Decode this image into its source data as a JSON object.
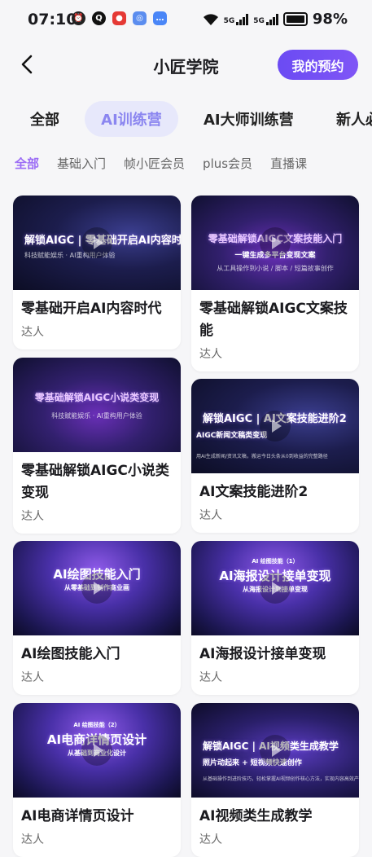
{
  "status": {
    "time": "07:10",
    "net1": "5G",
    "net2": "5G",
    "battery": "98%"
  },
  "header": {
    "title": "小匠学院",
    "booking_label": "我的预约"
  },
  "tabs": [
    "全部",
    "AI训练营",
    "AI大师训练营",
    "新人必"
  ],
  "subtabs": [
    "全部",
    "基础入门",
    "帧小匠会员",
    "plus会员",
    "直播课"
  ],
  "cards": [
    {
      "title": "零基础开启AI内容时代",
      "author": "达人",
      "thumb_main": "解锁AIGC | 零基础开启AI内容时代",
      "thumb_sub": "科技赋能娱乐 · AI重构用户体验"
    },
    {
      "title": "零基础解锁AIGC文案技能",
      "author": "达人",
      "thumb_main": "零基础解锁AIGC文案技能入门",
      "thumb_line2": "一键生成多平台变现文案",
      "thumb_sub": "从工具操作到小说 / 脚本 / 短篇故事创作"
    },
    {
      "title": "零基础解锁AIGC小说类变现",
      "author": "达人",
      "thumb_main": "零基础解锁AIGC小说类变现",
      "thumb_sub": "科技赋能娱乐 · AI重构用户体验"
    },
    {
      "title": "AI文案技能进阶2",
      "author": "达人",
      "thumb_main": "解锁AIGC | AI文案技能进阶2",
      "thumb_line2": "AIGC新闻文稿类变现",
      "thumb_sub": "用AI生成新闻/资讯文稿，搬运今日头条从0到收益的完整路径"
    },
    {
      "title": "AI绘图技能入门",
      "author": "达人",
      "thumb_main": "AI绘图技能入门",
      "thumb_line2": "从零基础到制作商业画"
    },
    {
      "title": "AI海报设计接单变现",
      "author": "达人",
      "thumb_tag": "AI 绘图技能（1）",
      "thumb_main": "AI海报设计接单变现",
      "thumb_line2": "从海报设计到接单变现"
    },
    {
      "title": "AI电商详情页设计",
      "author": "达人",
      "thumb_tag": "AI 绘图技能（2）",
      "thumb_main": "AI电商详情页设计",
      "thumb_line2": "从基础到商业化设计"
    },
    {
      "title": "AI视频类生成教学",
      "author": "达人",
      "thumb_main": "解锁AIGC | AI视频类生成教学",
      "thumb_line2": "照片动起来 + 短视频快速创作",
      "thumb_sub": "从基础操作到进阶技巧，轻松掌握AI视频创作核心方法，实现内容高效产出"
    }
  ],
  "colors": {
    "accent": "#7f55f6",
    "active_tab_bg": "#e7e8fb",
    "active_tab_text": "#8b86f0",
    "subtab_active": "#9b6cf5"
  },
  "icons": [
    "alarm-icon",
    "qq-icon",
    "app-icon",
    "app2-icon",
    "chat-icon",
    "wifi-icon",
    "back-arrow-icon",
    "play-icon"
  ]
}
